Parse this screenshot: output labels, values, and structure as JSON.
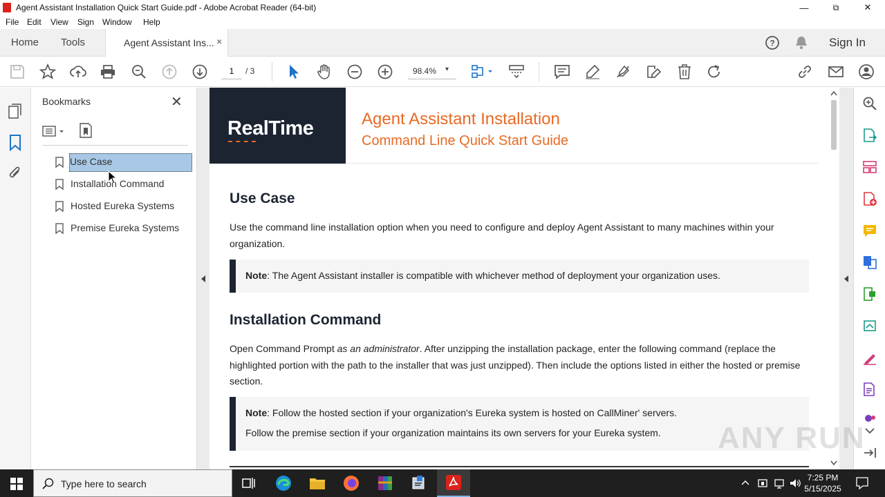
{
  "window": {
    "title": "Agent Assistant Installation Quick Start Guide.pdf - Adobe Acrobat Reader (64-bit)",
    "minimize": "—",
    "maximize": "⧉",
    "close": "✕"
  },
  "menu": [
    "File",
    "Edit",
    "View",
    "Sign",
    "Window",
    "Help"
  ],
  "tabs": {
    "home": "Home",
    "tools": "Tools",
    "document": "Agent Assistant Ins...",
    "document_close": "×",
    "sign_in": "Sign In"
  },
  "toolbar": {
    "page_current": "1",
    "page_total": "/ 3",
    "zoom": "98.4%",
    "zoom_caret": "▾",
    "icons": [
      "save-icon",
      "star-icon",
      "upload-icon",
      "print-icon",
      "search-zoom-icon",
      "page-up-icon",
      "page-down-icon",
      "select-cursor-icon",
      "hand-icon",
      "zoom-out-icon",
      "zoom-in-icon",
      "fit-page-icon",
      "scroll-mode-icon",
      "comment-icon",
      "highlight-icon",
      "draw-icon",
      "edit-icon",
      "delete-icon",
      "rotate-icon",
      "link-icon",
      "email-icon",
      "share-user-icon"
    ]
  },
  "bookmarks": {
    "header": "Bookmarks",
    "close": "✕",
    "items": [
      {
        "label": "Use Case",
        "selected": true
      },
      {
        "label": "Installation Command",
        "selected": false
      },
      {
        "label": "Hosted Eureka Systems",
        "selected": false
      },
      {
        "label": "Premise Eureka Systems",
        "selected": false
      }
    ]
  },
  "document": {
    "logo": "RealTime",
    "title_line1": "Agent Assistant Installation",
    "title_line2": "Command Line Quick Start Guide",
    "section1": {
      "heading": "Use Case",
      "body": "Use the command line installation option when you need to configure and deploy Agent Assistant to many machines within your organization.",
      "note_label": "Note",
      "note_text": ": The Agent Assistant installer is compatible with whichever method of deployment your organization uses."
    },
    "section2": {
      "heading": "Installation Command",
      "body_before": "Open Command Prompt ",
      "body_italic": "as an administrator",
      "body_after": ". After unzipping the installation package, enter the following command (replace the highlighted portion with the path to the installer that was just unzipped). Then include the options listed in either the hosted or premise section.",
      "note_label": "Note",
      "note_line1": ": Follow the hosted section if your organization's Eureka system is hosted on CallMiner' servers.",
      "note_line2": "Follow the premise section if your organization maintains its own servers for your Eureka system."
    }
  },
  "watermark": "ANY RUN",
  "taskbar": {
    "search_placeholder": "Type here to search",
    "time": "7:25 PM",
    "date": "5/15/2025"
  },
  "colors": {
    "accent_orange": "#e86a25",
    "dark_navy": "#1c2432",
    "selection_blue": "#a8c8e6",
    "icon_blue": "#1a73c8"
  }
}
